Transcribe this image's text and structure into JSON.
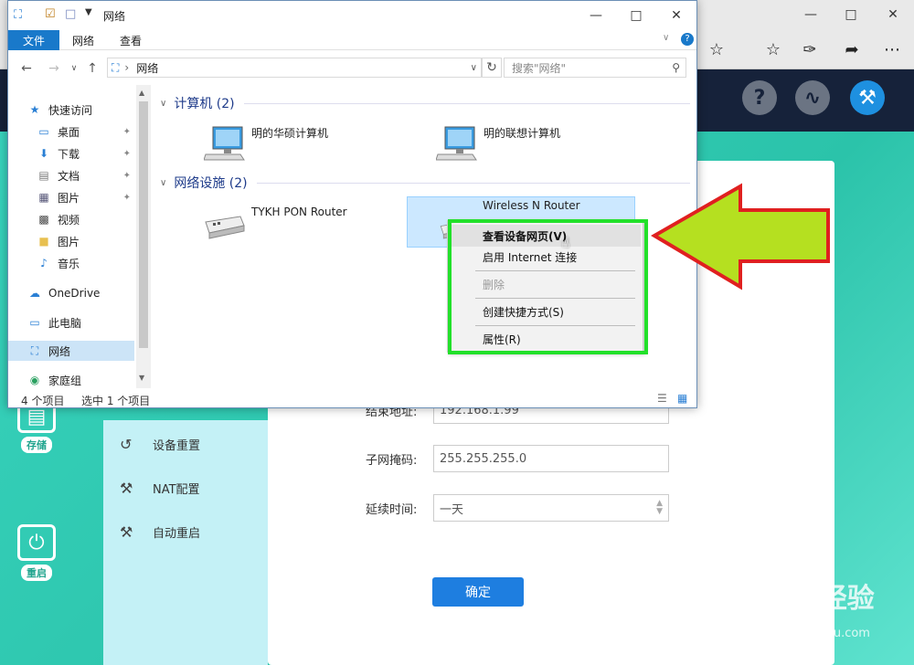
{
  "explorer": {
    "title": "网络",
    "ribbon_tabs": [
      "文件",
      "网络",
      "查看"
    ],
    "address": "网络",
    "search_placeholder": "搜索\"网络\"",
    "nav": {
      "quick_access": "快速访问",
      "items": [
        "桌面",
        "下载",
        "文档",
        "图片",
        "视频",
        "图片",
        "音乐"
      ],
      "onedrive": "OneDrive",
      "thispc": "此电脑",
      "network": "网络",
      "homegroup": "家庭组"
    },
    "groups": {
      "computers": "计算机 (2)",
      "devices": "网络设施 (2)"
    },
    "computers": [
      "明的华硕计算机",
      "明的联想计算机"
    ],
    "devices": [
      "TYKH PON Router",
      "Wireless N Router"
    ],
    "status": {
      "count": "4 个项目",
      "selected": "选中 1 个项目"
    }
  },
  "context_menu": {
    "items": [
      "查看设备网页(V)",
      "启用 Internet 连接",
      "删除",
      "创建快捷方式(S)",
      "属性(R)"
    ]
  },
  "router": {
    "menu": [
      "设备重置",
      "NAT配置",
      "自动重启"
    ],
    "rail": [
      "存储",
      "重启"
    ],
    "form": {
      "subnet_label": "子网掩码:",
      "subnet_value": "255.255.255.0",
      "lease_label": "延续时间:",
      "lease_value": "一天",
      "end_label": "结束地址:",
      "end_value": "192.168.1.99"
    },
    "confirm": "确定"
  }
}
